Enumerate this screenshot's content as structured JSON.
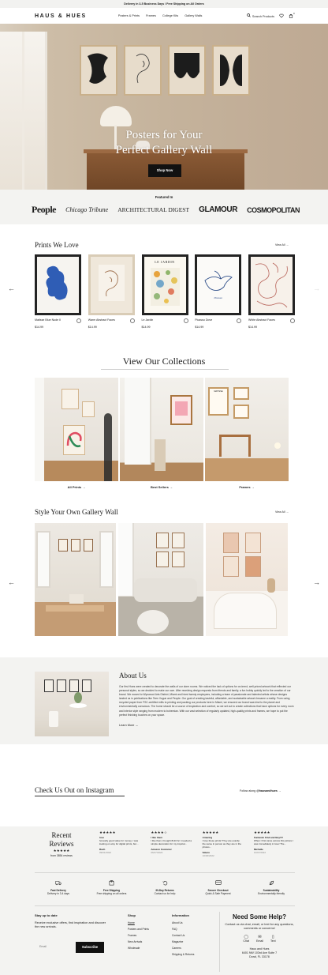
{
  "announcement": "Delivery in 3-5 Business Days / Free Shipping on All Orders",
  "header": {
    "logo": "HAUS & HUES",
    "nav": [
      "Posters & Prints",
      "Frames",
      "College Kits",
      "Gallery Walls"
    ],
    "search_label": "Search Products",
    "cart_count": "0",
    "icons": [
      "search-icon",
      "heart-icon",
      "cart-icon"
    ]
  },
  "hero": {
    "headline_line1": "Posters for Your",
    "headline_line2": "Perfect Gallery Wall",
    "cta": "Shop Now"
  },
  "featured": {
    "label": "Featured In",
    "brands": [
      "People",
      "Chicago Tribune",
      "ARCHITECTURAL DIGEST",
      "GLAMOUR",
      "COSMOPOLITAN"
    ]
  },
  "prints": {
    "title": "Prints We Love",
    "view_all": "View All →",
    "items": [
      {
        "name": "Matisse Blue Nude II",
        "price": "$14.99"
      },
      {
        "name": "Warm Abstract Faces",
        "price": "$14.99"
      },
      {
        "name": "Le Jardin",
        "price": "$14.99"
      },
      {
        "name": "Picasso Dove",
        "price": "$14.99"
      },
      {
        "name": "White Abstract Faces",
        "price": "$14.99"
      }
    ],
    "jardin_text": "LE JARDIN",
    "dove_text": "Picasso"
  },
  "collections": {
    "title": "View Our Collections",
    "items": [
      "All Prints →",
      "Best Sellers →",
      "Frames →"
    ],
    "poster_text": "MATISSE"
  },
  "gallery_wall": {
    "title": "Style Your Own Gallery Wall",
    "view_all": "View All →"
  },
  "about": {
    "title": "About Us",
    "body": "Our first Hues were created to decorate the walls of our dorm rooms. We noticed the lack of options for on-trend, well-priced artwork that reflected our personal styles, so we decided to make our own. After receiving design requests from friends and family, a fun hobby quickly led to the creation of our brand. We moved to Wynwood Arts District, Miami and hired twenty employees, including a team of passionate and talented artists whose designs landed us in publications like Teen Vogue and People. Our goal of creating tasteful, affordable, and sustainable artwork became a reality. From using recycled paper from FSC-certified mills to printing and packing our products here in Miami, we ensured our brand was kind to the planet and environmentally conscious. The home should be a source of inspiration and comfort, so we set out to create collections that have options for every room and interior style ranging from modern to bohemian. With our vast selection of regularly updated, high-quality prints and frames, we hope to put the perfect finishing touches on your space.",
    "more": "Learn More →"
  },
  "instagram": {
    "title": "Check Us Out on Instagram",
    "follow_prefix": "Follow along ",
    "handle": "@hausandhues",
    "follow_suffix": " →"
  },
  "reviews": {
    "summary_title": "Recent Reviews",
    "summary_stars": "★★★★★",
    "summary_count": "from 3854 reviews",
    "items": [
      {
        "stars": "★★★★★",
        "headline": "love",
        "text": "honestly good value for money. i was looking on etsy for digital prints, but...",
        "name": "Rach",
        "date": "09/01/2022"
      },
      {
        "stars": "★★★★☆",
        "headline": "I like them",
        "text": "I like them,I bought 8x10 bc I needed a simple decoration for my tropical...",
        "name": "Amazon Customer",
        "date": "06/27/2022"
      },
      {
        "stars": "★★★★★",
        "headline": "Amazing",
        "text": "I love these prints! They are exactly the same in person as they are in the photos...",
        "name": "Sdunn",
        "date": "10/30/2022"
      },
      {
        "stars": "★★★★★",
        "headline": "Fantastic Find and Buy!!!!",
        "text": "When I first came across this picture I was immediately in love! The...",
        "name": "Michelle",
        "date": "10/07/2022"
      }
    ]
  },
  "perks": [
    {
      "title": "Fast Delivery",
      "sub": "Delivery in 3-4 days",
      "icon": "truck-icon"
    },
    {
      "title": "Free Shipping",
      "sub": "Free shipping on all orders",
      "icon": "box-icon"
    },
    {
      "title": "30-Day Returns",
      "sub": "Contact us for help",
      "icon": "returns-icon"
    },
    {
      "title": "Secure Checkout",
      "sub": "Quick & Safe Payment",
      "icon": "card-icon"
    },
    {
      "title": "Sustainability",
      "sub": "Environmentally friendly",
      "icon": "leaf-icon"
    }
  ],
  "footer": {
    "newsletter_title": "Stay up to date",
    "newsletter_desc": "Receive exclusive offers, find inspiration and discover the new arrivals.",
    "email_placeholder": "Email",
    "subscribe": "Subscribe",
    "shop_title": "Shop",
    "shop_links": [
      "Home",
      "Posters and Prints",
      "Frames",
      "New Arrivals",
      "Wholesale"
    ],
    "info_title": "Information",
    "info_links": [
      "About Us",
      "FAQ",
      "Contact Us",
      "Magazine",
      "Careers",
      "Shipping & Returns"
    ],
    "help_title": "Need Some Help?",
    "help_desc": "Contact us via chat, email, or text for any questions, comments or concerns!",
    "help_options": [
      "Chat",
      "Email",
      "Text"
    ],
    "address_line1": "Haus and Hues",
    "address_line2": "6401 NW 103rd Ave Suite 7",
    "address_line3": "Doral, FL 33178"
  }
}
